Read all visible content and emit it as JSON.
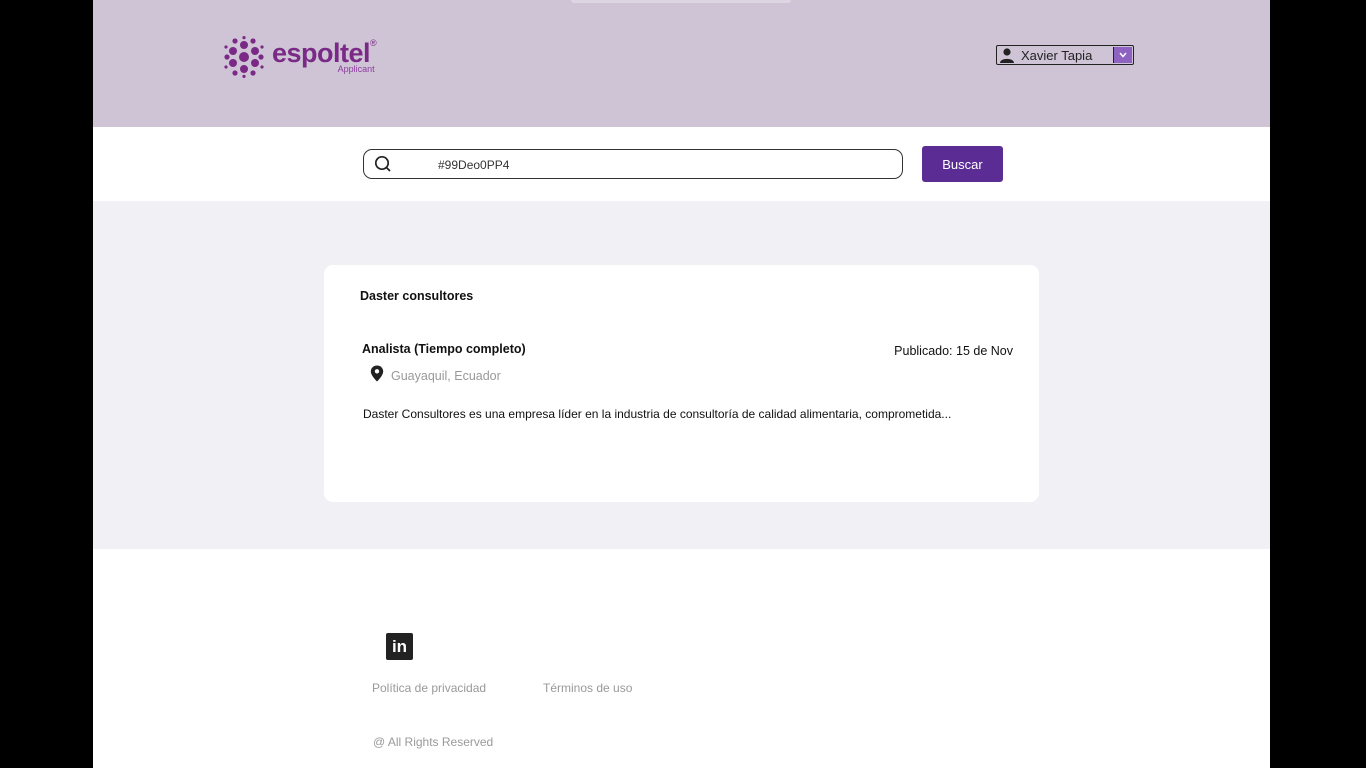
{
  "header": {
    "brand": "espoltel",
    "brand_reg": "®",
    "brand_sub": "Applicant",
    "user_name": "Xavier Tapia",
    "icons": {
      "user": "user-icon",
      "caret": "chevron-down-icon"
    },
    "colors": {
      "header_bg": "#cfc4d6",
      "brand": "#7a2a86",
      "caret_bg": "#8e62c1"
    }
  },
  "search": {
    "value": "#99Deo0PP4",
    "button_label": "Buscar",
    "icon": "search-icon",
    "colors": {
      "button_bg": "#5b2d94"
    }
  },
  "job": {
    "company": "Daster consultores",
    "title": "Analista (Tiempo completo)",
    "published": "Publicado: 15 de Nov",
    "location": "Guayaquil, Ecuador",
    "description": "Daster Consultores es una empresa líder en la industria de consultoría de calidad alimentaria, comprometida...",
    "icon": "location-pin-icon"
  },
  "footer": {
    "social_icon": "linkedin-icon",
    "social_glyph": "in",
    "privacy": "Política de privacidad",
    "terms": "Términos de uso",
    "rights": "@ All Rights Reserved"
  }
}
